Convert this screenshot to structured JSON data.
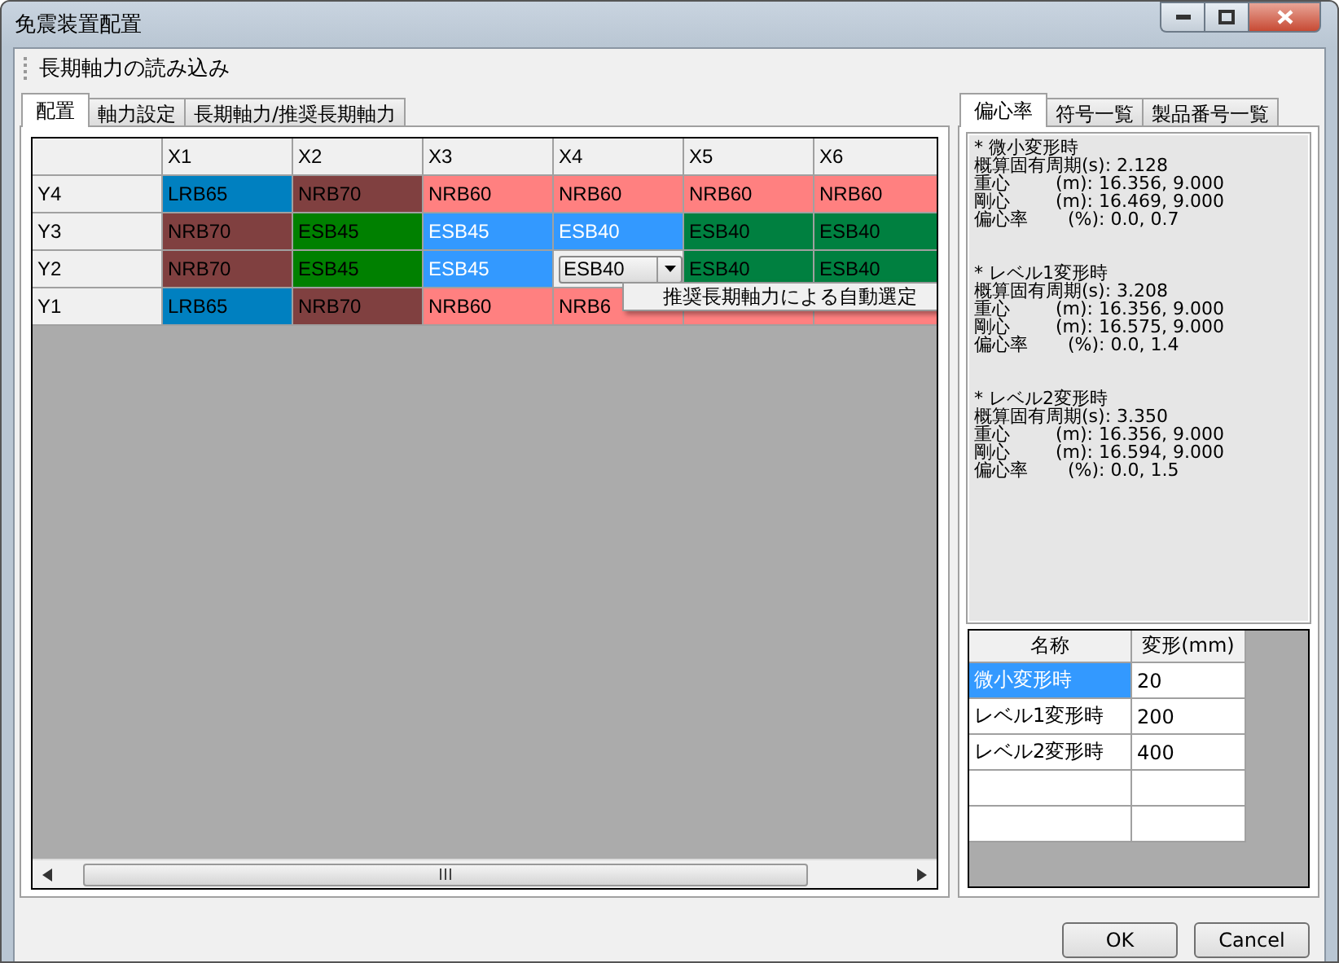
{
  "window": {
    "title": "免震装置配置"
  },
  "toolbar": {
    "label": "長期軸力の読み込み"
  },
  "left_tabs": [
    {
      "label": "配置",
      "selected": true
    },
    {
      "label": "軸力設定",
      "selected": false
    },
    {
      "label": "長期軸力/推奨長期軸力",
      "selected": false
    }
  ],
  "grid": {
    "columns": [
      "X1",
      "X2",
      "X3",
      "X4",
      "X5",
      "X6"
    ],
    "rows": [
      {
        "label": "Y4",
        "cells": [
          {
            "kind": "text",
            "text": "LRB65",
            "color": "#0080c0",
            "selected": false
          },
          {
            "kind": "text",
            "text": "NRB70",
            "color": "#804040",
            "selected": false
          },
          {
            "kind": "text",
            "text": "NRB60",
            "color": "#ff8080",
            "selected": false
          },
          {
            "kind": "text",
            "text": "NRB60",
            "color": "#ff8080",
            "selected": false
          },
          {
            "kind": "text",
            "text": "NRB60",
            "color": "#ff8080",
            "selected": false
          },
          {
            "kind": "text",
            "text": "NRB60",
            "color": "#ff8080",
            "selected": false
          }
        ]
      },
      {
        "label": "Y3",
        "cells": [
          {
            "kind": "text",
            "text": "NRB70",
            "color": "#804040",
            "selected": false
          },
          {
            "kind": "text",
            "text": "ESB45",
            "color": "#008000",
            "selected": false
          },
          {
            "kind": "text",
            "text": "ESB45",
            "selected": true
          },
          {
            "kind": "text",
            "text": "ESB40",
            "selected": true
          },
          {
            "kind": "text",
            "text": "ESB40",
            "color": "#008040",
            "selected": false
          },
          {
            "kind": "text",
            "text": "ESB40",
            "color": "#008040",
            "selected": false
          }
        ]
      },
      {
        "label": "Y2",
        "cells": [
          {
            "kind": "text",
            "text": "NRB70",
            "color": "#804040",
            "selected": false
          },
          {
            "kind": "text",
            "text": "ESB45",
            "color": "#008000",
            "selected": false
          },
          {
            "kind": "text",
            "text": "ESB45",
            "selected": true
          },
          {
            "kind": "combo",
            "text": "ESB40",
            "selected": false
          },
          {
            "kind": "text",
            "text": "ESB40",
            "color": "#008040",
            "selected": false
          },
          {
            "kind": "text",
            "text": "ESB40",
            "color": "#008040",
            "selected": false
          }
        ]
      },
      {
        "label": "Y1",
        "cells": [
          {
            "kind": "text",
            "text": "LRB65",
            "color": "#0080c0",
            "selected": false
          },
          {
            "kind": "text",
            "text": "NRB70",
            "color": "#804040",
            "selected": false
          },
          {
            "kind": "text",
            "text": "NRB60",
            "color": "#ff8080",
            "selected": false
          },
          {
            "kind": "text",
            "text": "NRB6",
            "color": "#ff8080",
            "selected": false
          },
          {
            "kind": "text",
            "color": "#ff8080",
            "selected": false
          },
          {
            "kind": "text",
            "color": "#ff8080",
            "selected": false
          }
        ]
      }
    ]
  },
  "context_menu": {
    "items": [
      "推奨長期軸力による自動選定"
    ]
  },
  "right_tabs": [
    {
      "label": "偏心率",
      "selected": true
    },
    {
      "label": "符号一覧",
      "selected": false
    },
    {
      "label": "製品番号一覧",
      "selected": false
    }
  ],
  "report": [
    {
      "title": "* 微小変形時",
      "lines": [
        "概算固有周期(s): 2.128",
        "重心        (m): 16.356, 9.000",
        "剛心        (m): 16.469, 9.000",
        "偏心率       (%): 0.0, 0.7"
      ]
    },
    {
      "title": "* レベル1変形時",
      "lines": [
        "概算固有周期(s): 3.208",
        "重心        (m): 16.356, 9.000",
        "剛心        (m): 16.575, 9.000",
        "偏心率       (%): 0.0, 1.4"
      ]
    },
    {
      "title": "* レベル2変形時",
      "lines": [
        "概算固有周期(s): 3.350",
        "重心        (m): 16.356, 9.000",
        "剛心        (m): 16.594, 9.000",
        "偏心率       (%): 0.0, 1.5"
      ]
    }
  ],
  "deformation_table": {
    "columns": [
      "名称",
      "変形(mm)"
    ],
    "rows": [
      {
        "name": "微小変形時",
        "value": "20",
        "selected": true
      },
      {
        "name": "レベル1変形時",
        "value": "200",
        "selected": false
      },
      {
        "name": "レベル2変形時",
        "value": "400",
        "selected": false
      }
    ]
  },
  "buttons": [
    "OK",
    "Cancel"
  ]
}
